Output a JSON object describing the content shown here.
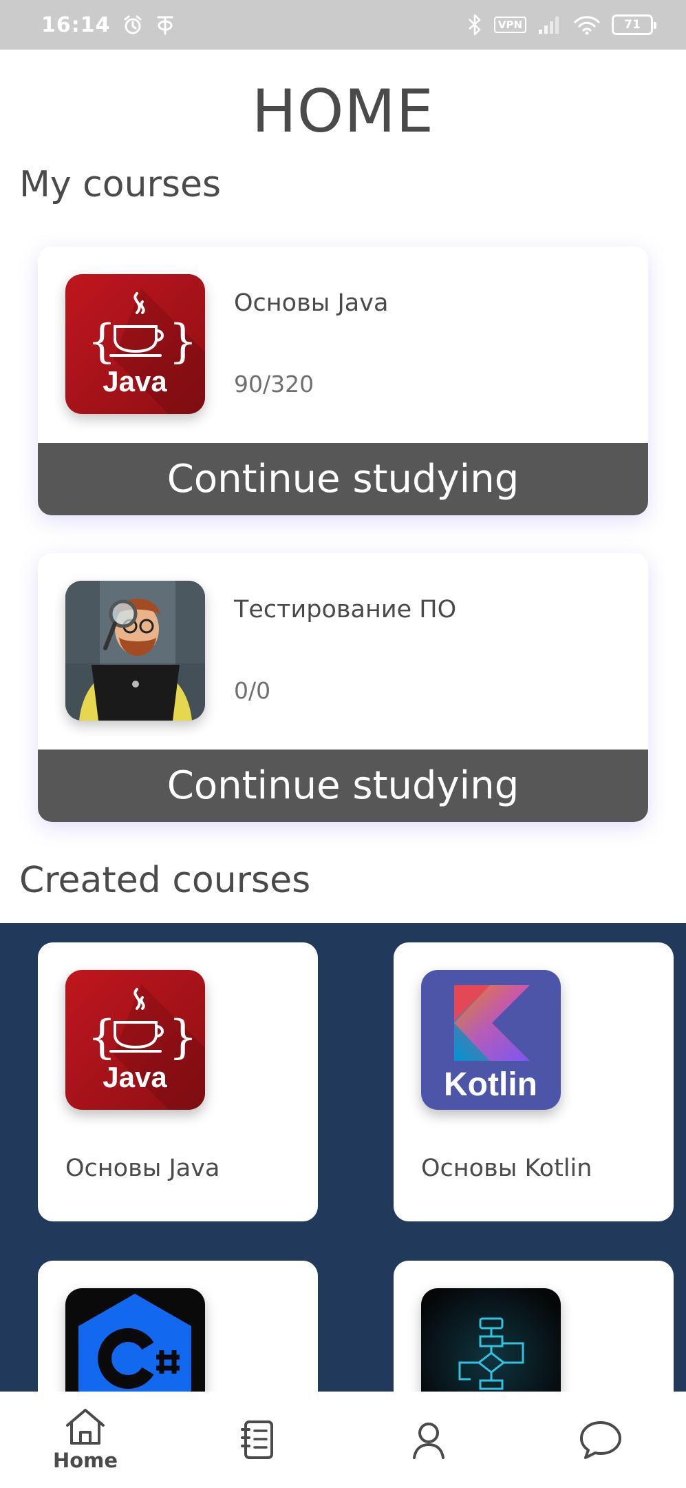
{
  "status_bar": {
    "time": "16:14",
    "vpn": "VPN",
    "battery": "71"
  },
  "page": {
    "title": "HOME"
  },
  "my_courses": {
    "heading": "My courses",
    "items": [
      {
        "name": "Основы Java",
        "progress": "90/320",
        "button": "Continue studying",
        "thumb": "java-logo"
      },
      {
        "name": "Тестирование ПО",
        "progress": "0/0",
        "button": "Continue studying",
        "thumb": "tester-illustration"
      }
    ]
  },
  "created_courses": {
    "heading": "Created courses",
    "items": [
      {
        "name": "Основы Java",
        "thumb": "java-logo"
      },
      {
        "name": "Основы Kotlin",
        "thumb": "kotlin-logo",
        "logo_text": "Kotlin"
      },
      {
        "name": "",
        "thumb": "csharp-logo"
      },
      {
        "name": "",
        "thumb": "flowchart-icon"
      }
    ]
  },
  "bottom_nav": {
    "items": [
      {
        "label": "Home",
        "icon": "home-icon",
        "active": true
      },
      {
        "label": "",
        "icon": "notebook-icon",
        "active": false
      },
      {
        "label": "",
        "icon": "profile-icon",
        "active": false
      },
      {
        "label": "",
        "icon": "chat-icon",
        "active": false
      }
    ]
  },
  "colors": {
    "status_bar_bg": "#cbcbcb",
    "button_bg": "#575757",
    "created_panel_bg": "#213a5c",
    "java_red": "#b3151c",
    "kotlin_bg": "#4d55a8",
    "text": "#4a4a4a"
  }
}
